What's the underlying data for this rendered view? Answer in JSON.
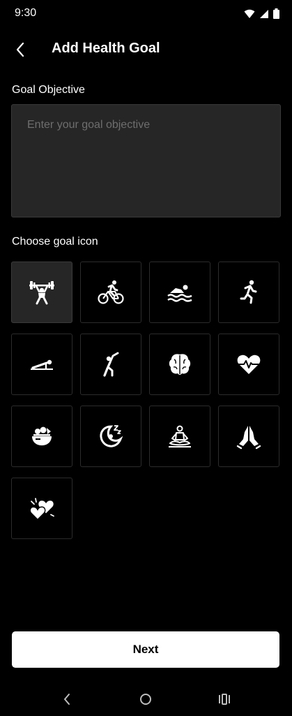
{
  "status_bar": {
    "time": "9:30",
    "icons": [
      "wifi-icon",
      "cell-signal-icon",
      "battery-icon"
    ]
  },
  "header": {
    "back_icon": "chevron-left-icon",
    "title": "Add Health Goal"
  },
  "goal_objective": {
    "label": "Goal Objective",
    "value": "",
    "placeholder": "Enter your goal objective"
  },
  "icon_picker": {
    "label": "Choose goal icon",
    "selected_index": 0,
    "icons": [
      "weightlifting-icon",
      "cycling-icon",
      "swimming-icon",
      "running-icon",
      "pushup-icon",
      "stretching-icon",
      "brain-icon",
      "heartbeat-icon",
      "salad-bowl-icon",
      "sleep-icon",
      "meditation-icon",
      "praying-hands-icon",
      "hearts-icon"
    ]
  },
  "actions": {
    "next_label": "Next"
  },
  "system_nav": {
    "icons": [
      "nav-back-icon",
      "nav-home-icon",
      "nav-recents-icon"
    ]
  },
  "colors": {
    "background": "#000000",
    "input_background": "#262626",
    "tile_border": "#2c2c2c",
    "selected_tile": "#262626",
    "placeholder": "#6e6e6e",
    "primary_button": "#ffffff",
    "primary_button_text": "#000000"
  }
}
